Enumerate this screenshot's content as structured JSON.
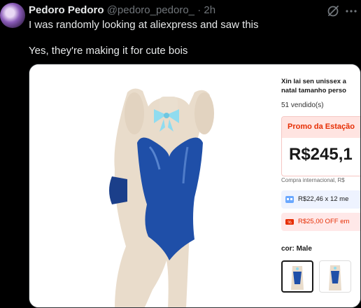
{
  "tweet": {
    "author_name": "Pedoro Pedoro",
    "handle": "@pedoro_pedoro_",
    "separator": "·",
    "time": "2h",
    "line1": "I was randomly looking at aliexpress and saw this",
    "line2": "Yes, they're making it for cute bois"
  },
  "icons": {
    "grok": "grok-icon",
    "more": "more-icon",
    "installment": "card-icon",
    "coupon": "coupon-icon"
  },
  "product": {
    "title_line1": "Xin lai sen unissex a",
    "title_line2": "natal tamanho perso",
    "sold": "51 vendido(s)",
    "promo_label": "Promo da Estação",
    "price": "R$245,1",
    "international_note": "Compra internacional, R$",
    "installment": "R$22,46 x 12 me",
    "coupon": "R$25,00 OFF em",
    "color_label": "cor: Male"
  },
  "colors": {
    "background": "#000000",
    "text_primary": "#e7e9ea",
    "text_secondary": "#71767b",
    "promo_red": "#e62e04",
    "costume_blue": "#1f4fa8",
    "bow_cyan": "#8fdcf0"
  }
}
